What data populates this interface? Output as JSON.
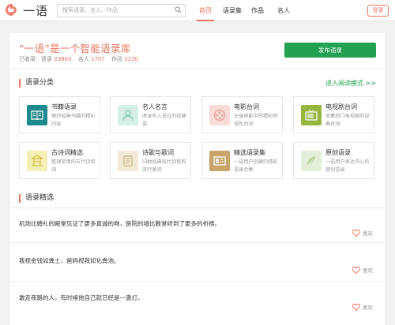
{
  "header": {
    "logo_text": "一语",
    "search_placeholder": "搜索语录、名人、作品",
    "nav": [
      "首页",
      "语录集",
      "作品",
      "名人"
    ],
    "login_label": "登录"
  },
  "hero": {
    "title": "“一语”是一个智能语录库",
    "stats_prefix": "已收录：语录",
    "quotes_count": "23863",
    "people_label": "名人",
    "people_count": "1707",
    "works_label": "作品",
    "works_count": "3230",
    "publish_label": "发布语录"
  },
  "categories_section": {
    "title": "语录分类",
    "more_label": "进入阅读模式 >>",
    "items": [
      {
        "name": "书籍语录",
        "desc": "摘抄经典书籍的精彩内容",
        "icon": "book-icon",
        "color": "#1f8a8d"
      },
      {
        "name": "名人名言",
        "desc": "收录名人说过的经典语",
        "icon": "person-icon",
        "color": "#d4efe6"
      },
      {
        "name": "电影台词",
        "desc": "记录电影中的精彩桥段和台词",
        "icon": "film-icon",
        "color": "#f7dcd8"
      },
      {
        "name": "电视剧台词",
        "desc": "收集热门电视剧的经典台词",
        "icon": "tv-icon",
        "color": "#97b640"
      },
      {
        "name": "古诗词精选",
        "desc": "整理常用的古代诗和词",
        "icon": "pavilion-icon",
        "color": "#f6f0b6"
      },
      {
        "name": "诗歌与歌词",
        "desc": "归纳经典现代诗歌和流行歌词",
        "icon": "scroll-icon",
        "color": "#f2ead4"
      },
      {
        "name": "精选语录集",
        "desc": "一语用户创建的精彩语录合集",
        "icon": "folder-icon",
        "color": "#c8a46a"
      },
      {
        "name": "原创语录",
        "desc": "一语用户表达内心的原创语录",
        "icon": "feather-icon",
        "color": "#e3efd8"
      }
    ]
  },
  "quotes_section": {
    "title": "语录精选",
    "like_label": "喜欢",
    "items": [
      "机场比婚礼的殿堂见证了更多真诚的吻，医院的墙比教堂听到了更多的祈祷。",
      "我视金钱如粪土，爸妈视我如化粪池。",
      "敢走夜路的人，有时候他自己就已经是一盏灯。"
    ]
  },
  "colors": {
    "accent": "#e8735f",
    "green": "#22a152"
  }
}
